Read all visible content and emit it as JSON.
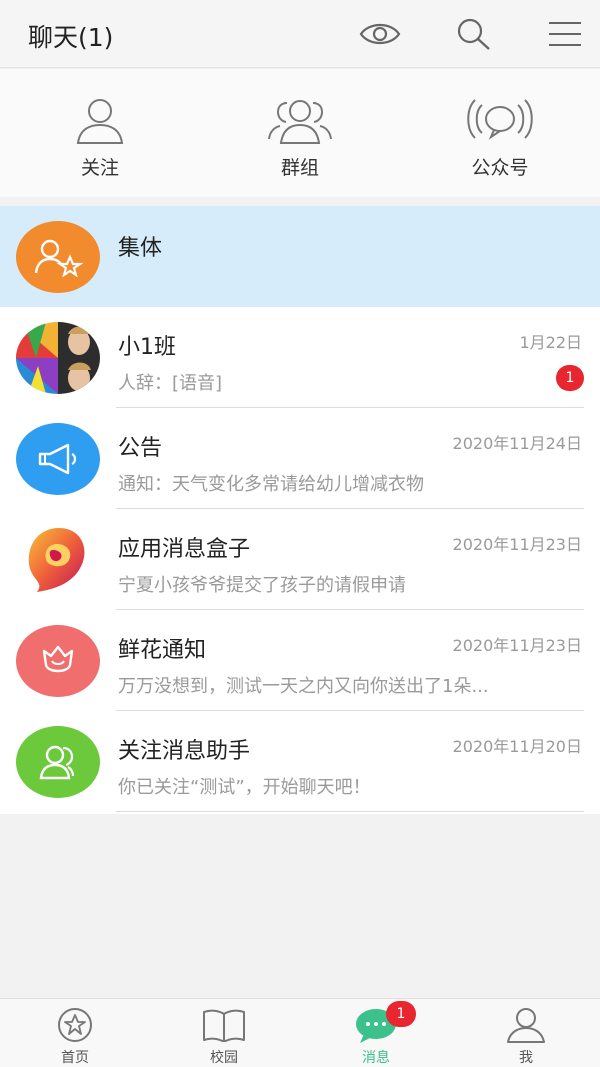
{
  "header": {
    "title": "聊天(1)",
    "icons": [
      "eye-icon",
      "search-icon",
      "menu-icon"
    ]
  },
  "quick_actions": [
    {
      "label": "关注",
      "icon": "person-icon"
    },
    {
      "label": "群组",
      "icon": "group-icon"
    },
    {
      "label": "公众号",
      "icon": "broadcast-icon"
    }
  ],
  "chats": [
    {
      "name": "集体",
      "time": "",
      "preview": "",
      "badge": "",
      "avatar_icon": "collective-icon",
      "avatar_color": "#f28a2e"
    },
    {
      "name": "小1班",
      "time": "1月22日",
      "preview": "人辞：[语音]",
      "badge": "1",
      "avatar_icon": "group-photo-icon",
      "avatar_color": "#555555"
    },
    {
      "name": "公告",
      "time": "2020年11月24日",
      "preview": "通知：天气变化多常请给幼儿增减衣物",
      "badge": "",
      "avatar_icon": "megaphone-icon",
      "avatar_color": "#2f9df0"
    },
    {
      "name": "应用消息盒子",
      "time": "2020年11月23日",
      "preview": "宁夏小孩爷爷提交了孩子的请假申请",
      "badge": "",
      "avatar_icon": "app-box-icon",
      "avatar_color": "#e0234a"
    },
    {
      "name": "鲜花通知",
      "time": "2020年11月23日",
      "preview": "万万没想到，测试一天之内又向你送出了1朵...",
      "badge": "",
      "avatar_icon": "flower-icon",
      "avatar_color": "#f06e6e"
    },
    {
      "name": "关注消息助手",
      "time": "2020年11月20日",
      "preview": "你已关注“测试”，开始聊天吧！",
      "badge": "",
      "avatar_icon": "follow-assistant-icon",
      "avatar_color": "#6cc93b"
    }
  ],
  "tabbar": {
    "tabs": [
      {
        "label": "首页",
        "icon": "star-icon",
        "active": false
      },
      {
        "label": "校园",
        "icon": "book-icon",
        "active": false
      },
      {
        "label": "消息",
        "icon": "chat-bubble-icon",
        "active": true,
        "badge": "1"
      },
      {
        "label": "我",
        "icon": "profile-icon",
        "active": false
      }
    ]
  },
  "colors": {
    "highlight_row": "#d6ecfb",
    "badge": "#e8262f",
    "active_tab": "#3cc08c"
  }
}
